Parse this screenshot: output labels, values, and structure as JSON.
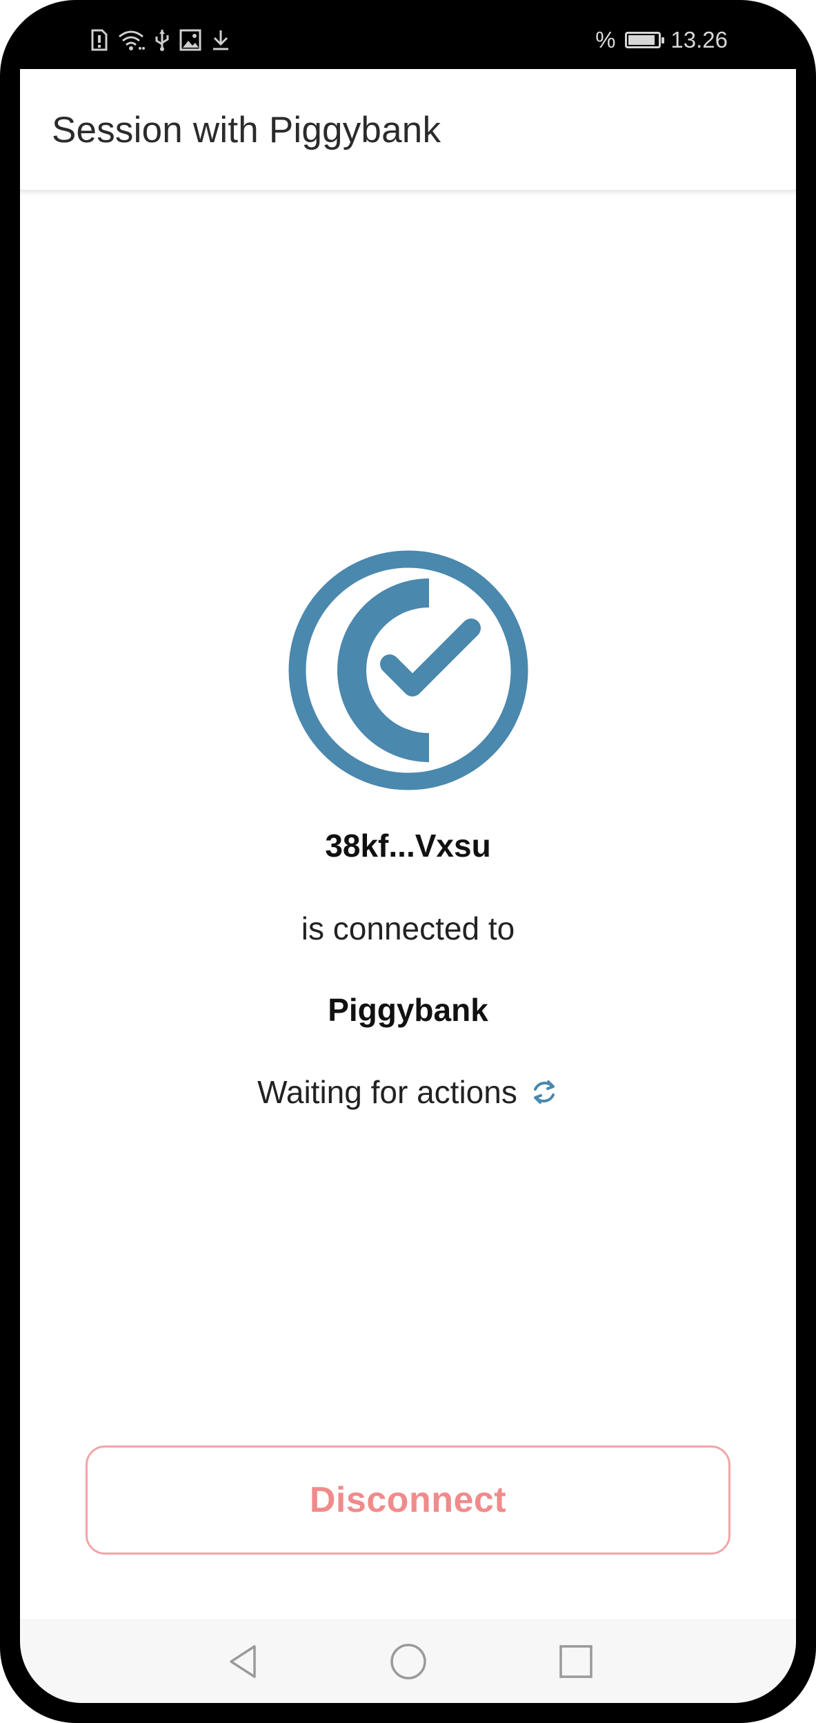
{
  "status_bar": {
    "left_icons": [
      "sim-alert-icon",
      "wifi-icon",
      "usb-icon",
      "image-icon",
      "download-icon"
    ],
    "battery_percent_sign": "%",
    "time": "13.26"
  },
  "app_bar": {
    "title": "Session with Piggybank"
  },
  "session": {
    "address": "38kf...Vxsu",
    "connected_text": "is connected to",
    "dapp_name": "Piggybank",
    "status_text": "Waiting for actions"
  },
  "actions": {
    "disconnect_label": "Disconnect"
  },
  "nav_bar": {
    "buttons": [
      "back-icon",
      "home-icon",
      "recents-icon"
    ]
  },
  "colors": {
    "brand_blue": "#4A88AE",
    "disconnect_red": "#F08B8B",
    "disconnect_border": "#F2A5A5"
  }
}
